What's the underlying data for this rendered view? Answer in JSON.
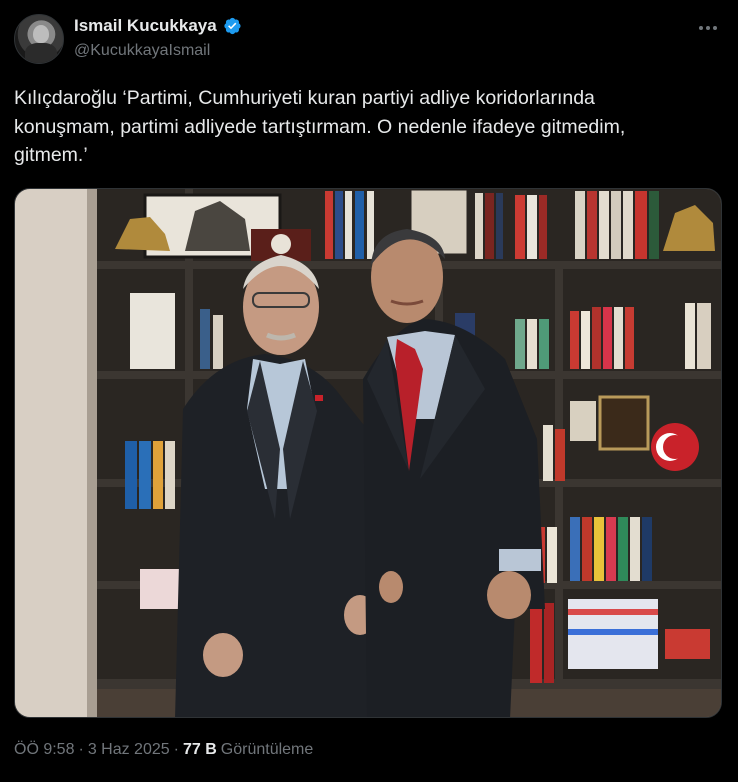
{
  "author": {
    "display_name": "Ismail Kucukkaya",
    "handle": "@KucukkayaIsmail",
    "verified": true
  },
  "tweet": {
    "text_lines": [
      "Kılıçdaroğlu ‘Partimi, Cumhuriyeti kuran partiyi adliye koridorlarında",
      "konuşmam, partimi adliyede tartıştırmam. O nedenle ifadeye gitmedim,",
      "gitmem.’"
    ]
  },
  "meta": {
    "time": "ÖÖ 9:58",
    "separator": "·",
    "date": "3 Haz 2025",
    "views_count": "77 B",
    "views_label": "Görüntüleme"
  },
  "colors": {
    "background": "#000000",
    "text": "#e7e9ea",
    "muted": "#71767b",
    "verified": "#1d9bf0"
  },
  "icons": {
    "verified": "verified-badge-icon",
    "more": "more-dots-icon"
  }
}
